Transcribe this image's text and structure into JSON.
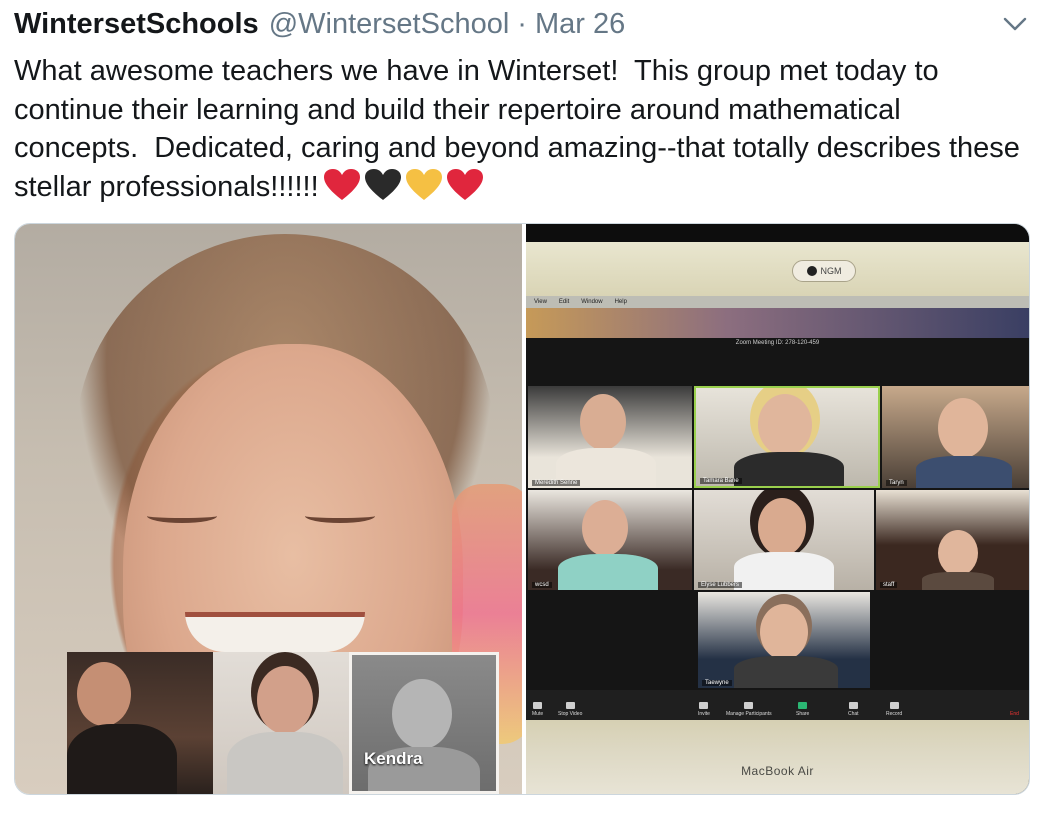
{
  "tweet": {
    "author_name": "WintersetSchools",
    "author_handle": "@WintersetSchool",
    "separator": "·",
    "date": "Mar 26",
    "text": "What awesome teachers we have in Winterset!  This group met today to continue their learning and build their repertoire around mathematical concepts.  Dedicated, caring and beyond amazing--that totally describes these stellar professionals!!!!!!",
    "hearts": [
      {
        "name": "red-heart-icon",
        "color": "#e0263d"
      },
      {
        "name": "black-heart-icon",
        "color": "#2a2a2a"
      },
      {
        "name": "yellow-heart-icon",
        "color": "#f5c043"
      },
      {
        "name": "red-heart-icon",
        "color": "#e0263d"
      }
    ],
    "menu_icon": "chevron-down-icon"
  },
  "left_photo": {
    "thumbnail_name": "Kendra"
  },
  "right_photo": {
    "camera_label": "NGM",
    "menu_items": [
      "View",
      "Edit",
      "Window",
      "Help"
    ],
    "meeting_id": "Zoom Meeting ID: 278-120-459",
    "participants": [
      "Meredith Senne",
      "Tamara Bane",
      "Taryn",
      "wcsd",
      "Elyse Lubbers",
      "staff",
      "Taewyne"
    ],
    "toolbar": [
      "Mute",
      "Stop Video",
      "Invite",
      "Manage Participants",
      "Share",
      "Chat",
      "Record",
      "End"
    ],
    "laptop_label": "MacBook Air"
  },
  "colors": {
    "text": "#14171a",
    "muted": "#657786",
    "border": "#ccd6dd"
  }
}
